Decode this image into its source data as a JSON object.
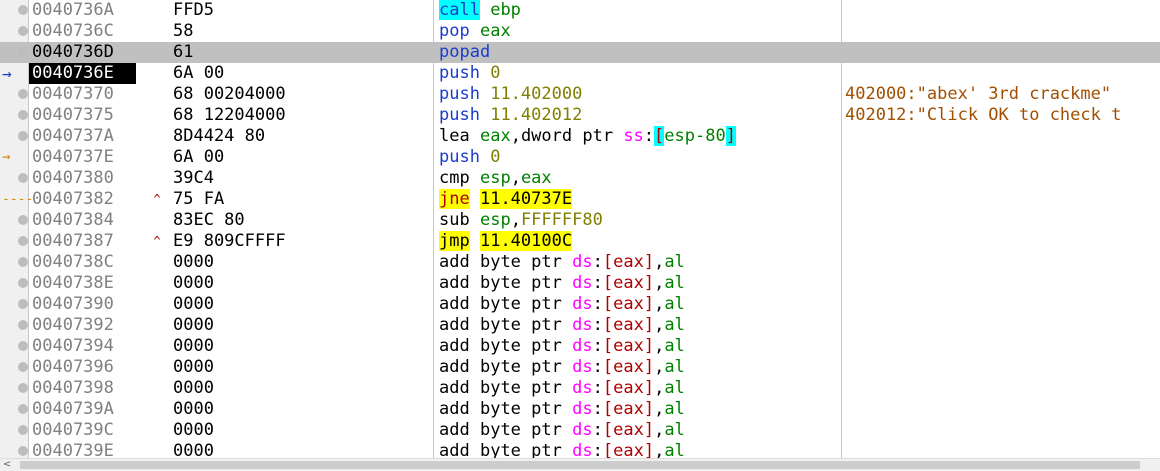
{
  "colors": {
    "mnemonic": "#1a3ccc",
    "number": "#808000",
    "register": "#008000",
    "segment": "#ff00ff",
    "bracket": "#b00000",
    "comment": "#a05000",
    "highlight_cyan": "#00ffff",
    "highlight_yellow": "#ffff00",
    "selected_row": "#c0c0c0",
    "eip_address_bg": "#000000"
  },
  "rows": [
    {
      "addr": "0040736A",
      "bytes": "FFD5",
      "gutter": "dot",
      "jmp": "",
      "comment": "",
      "tokens": [
        {
          "t": "call",
          "c": "mn",
          "hl": "cyan"
        },
        {
          "t": " "
        },
        {
          "t": "ebp",
          "c": "reg"
        }
      ]
    },
    {
      "addr": "0040736C",
      "bytes": "58",
      "gutter": "dot",
      "jmp": "",
      "comment": "",
      "tokens": [
        {
          "t": "pop",
          "c": "mn"
        },
        {
          "t": " "
        },
        {
          "t": "eax",
          "c": "reg"
        }
      ]
    },
    {
      "addr": "0040736D",
      "bytes": "61",
      "gutter": "dot",
      "jmp": "",
      "comment": "",
      "selected": true,
      "tokens": [
        {
          "t": "popad",
          "c": "mn"
        }
      ]
    },
    {
      "addr": "0040736E",
      "bytes": "6A 00",
      "gutter": "eip",
      "jmp": "",
      "comment": "",
      "eip": true,
      "tokens": [
        {
          "t": "push",
          "c": "mn"
        },
        {
          "t": " "
        },
        {
          "t": "0",
          "c": "num"
        }
      ]
    },
    {
      "addr": "00407370",
      "bytes": "68 00204000",
      "gutter": "dot",
      "jmp": "",
      "comment": "402000:\"abex' 3rd crackme\"",
      "tokens": [
        {
          "t": "push",
          "c": "mn"
        },
        {
          "t": " "
        },
        {
          "t": "11.402000",
          "c": "num"
        }
      ]
    },
    {
      "addr": "00407375",
      "bytes": "68 12204000",
      "gutter": "dot",
      "jmp": "",
      "comment": "402012:\"Click OK to check t",
      "tokens": [
        {
          "t": "push",
          "c": "mn"
        },
        {
          "t": " "
        },
        {
          "t": "11.402012",
          "c": "num"
        }
      ]
    },
    {
      "addr": "0040737A",
      "bytes": "8D4424 80",
      "gutter": "dot",
      "jmp": "",
      "comment": "",
      "tokens": [
        {
          "t": "lea",
          "c": "plain"
        },
        {
          "t": " "
        },
        {
          "t": "eax",
          "c": "reg"
        },
        {
          "t": ","
        },
        {
          "t": "dword ptr",
          "c": "plain"
        },
        {
          "t": " "
        },
        {
          "t": "ss",
          "c": "seg"
        },
        {
          "t": ":"
        },
        {
          "t": "[",
          "c": "br",
          "hl": "bracket"
        },
        {
          "t": "esp-80",
          "c": "reg"
        },
        {
          "t": "]",
          "c": "br",
          "hl": "bracket"
        }
      ]
    },
    {
      "addr": "0040737E",
      "bytes": "6A 00",
      "gutter": "jt",
      "jmp": "",
      "comment": "",
      "tokens": [
        {
          "t": "push",
          "c": "mn"
        },
        {
          "t": " "
        },
        {
          "t": "0",
          "c": "num"
        }
      ]
    },
    {
      "addr": "00407380",
      "bytes": "39C4",
      "gutter": "dot",
      "jmp": "",
      "comment": "",
      "tokens": [
        {
          "t": "cmp",
          "c": "plain"
        },
        {
          "t": " "
        },
        {
          "t": "esp",
          "c": "reg"
        },
        {
          "t": ","
        },
        {
          "t": "eax",
          "c": "reg"
        }
      ]
    },
    {
      "addr": "00407382",
      "bytes": "75 FA",
      "gutter": "jtdash",
      "jmp": "^",
      "comment": "",
      "tokens": [
        {
          "t": "jne",
          "c": "br",
          "hl": "yellow"
        },
        {
          "t": " "
        },
        {
          "t": "11.40737E",
          "c": "plain",
          "hl": "yellow"
        }
      ]
    },
    {
      "addr": "00407384",
      "bytes": "83EC 80",
      "gutter": "dot",
      "jmp": "",
      "comment": "",
      "tokens": [
        {
          "t": "sub",
          "c": "plain"
        },
        {
          "t": " "
        },
        {
          "t": "esp",
          "c": "reg"
        },
        {
          "t": ","
        },
        {
          "t": "FFFFFF80",
          "c": "num"
        }
      ]
    },
    {
      "addr": "00407387",
      "bytes": "E9 809CFFFF",
      "gutter": "dot",
      "jmp": "^",
      "comment": "",
      "tokens": [
        {
          "t": "jmp",
          "c": "plain",
          "hl": "yellow"
        },
        {
          "t": " "
        },
        {
          "t": "11.40100C",
          "c": "plain",
          "hl": "yellow"
        }
      ]
    },
    {
      "addr": "0040738C",
      "bytes": "0000",
      "gutter": "dot",
      "jmp": "",
      "comment": "",
      "add": true
    },
    {
      "addr": "0040738E",
      "bytes": "0000",
      "gutter": "dot",
      "jmp": "",
      "comment": "",
      "add": true
    },
    {
      "addr": "00407390",
      "bytes": "0000",
      "gutter": "dot",
      "jmp": "",
      "comment": "",
      "add": true
    },
    {
      "addr": "00407392",
      "bytes": "0000",
      "gutter": "dot",
      "jmp": "",
      "comment": "",
      "add": true
    },
    {
      "addr": "00407394",
      "bytes": "0000",
      "gutter": "dot",
      "jmp": "",
      "comment": "",
      "add": true
    },
    {
      "addr": "00407396",
      "bytes": "0000",
      "gutter": "dot",
      "jmp": "",
      "comment": "",
      "add": true
    },
    {
      "addr": "00407398",
      "bytes": "0000",
      "gutter": "dot",
      "jmp": "",
      "comment": "",
      "add": true
    },
    {
      "addr": "0040739A",
      "bytes": "0000",
      "gutter": "dot",
      "jmp": "",
      "comment": "",
      "add": true
    },
    {
      "addr": "0040739C",
      "bytes": "0000",
      "gutter": "dot",
      "jmp": "",
      "comment": "",
      "add": true
    },
    {
      "addr": "0040739E",
      "bytes": "0000",
      "gutter": "dot",
      "jmp": "",
      "comment": "",
      "add": true
    }
  ],
  "add_instruction": [
    {
      "t": "add",
      "c": "plain"
    },
    {
      "t": " "
    },
    {
      "t": "byte ptr",
      "c": "plain"
    },
    {
      "t": " "
    },
    {
      "t": "ds",
      "c": "seg"
    },
    {
      "t": ":"
    },
    {
      "t": "[",
      "c": "br"
    },
    {
      "t": "eax",
      "c": "br"
    },
    {
      "t": "]",
      "c": "br"
    },
    {
      "t": ","
    },
    {
      "t": "al",
      "c": "reg"
    }
  ],
  "scrollbar": {
    "left_arrow": "<"
  }
}
